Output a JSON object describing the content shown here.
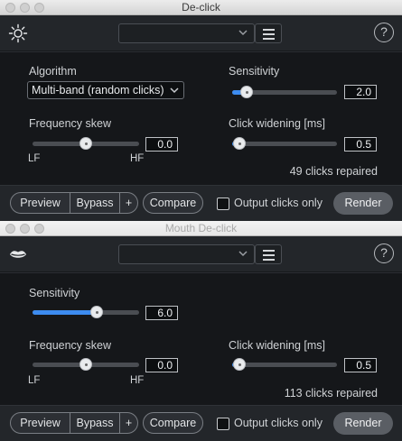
{
  "colors": {
    "accent": "#3d8cf0",
    "panel": "#15171a",
    "header": "#23262a"
  },
  "modules": [
    {
      "title": "De-click",
      "icon": "sun-icon",
      "preset_value": "",
      "help": "?",
      "params": {
        "algorithm": {
          "label": "Algorithm",
          "value": "Multi-band (random clicks)"
        },
        "sensitivity": {
          "label": "Sensitivity",
          "value": "2.0",
          "fraction": 0.14
        },
        "frequency_skew": {
          "label": "Frequency skew",
          "value": "0.0",
          "fraction": 0.5,
          "low": "LF",
          "high": "HF"
        },
        "click_widening": {
          "label": "Click widening [ms]",
          "value": "0.5",
          "fraction": 0.07
        }
      },
      "status": "49 clicks repaired",
      "footer": {
        "preview": "Preview",
        "bypass": "Bypass",
        "plus": "+",
        "compare": "Compare",
        "output_clicks_only": "Output clicks only",
        "render": "Render"
      }
    },
    {
      "title": "Mouth De-click",
      "icon": "lips-icon",
      "preset_value": "",
      "help": "?",
      "params": {
        "sensitivity": {
          "label": "Sensitivity",
          "value": "6.0",
          "fraction": 0.6
        },
        "frequency_skew": {
          "label": "Frequency skew",
          "value": "0.0",
          "fraction": 0.5,
          "low": "LF",
          "high": "HF"
        },
        "click_widening": {
          "label": "Click widening [ms]",
          "value": "0.5",
          "fraction": 0.07
        }
      },
      "status": "113 clicks repaired",
      "footer": {
        "preview": "Preview",
        "bypass": "Bypass",
        "plus": "+",
        "compare": "Compare",
        "output_clicks_only": "Output clicks only",
        "render": "Render"
      }
    }
  ]
}
